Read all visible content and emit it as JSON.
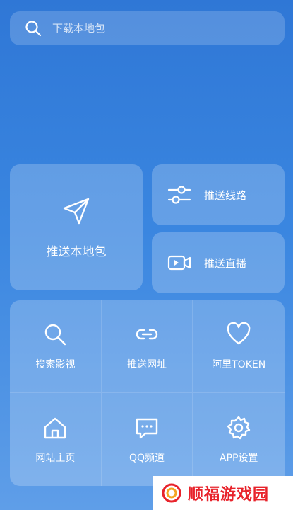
{
  "search": {
    "placeholder": "下载本地包"
  },
  "cards": {
    "push_package": {
      "label": "推送本地包",
      "icon": "send-icon"
    },
    "push_route": {
      "label": "推送线路",
      "icon": "sliders-icon"
    },
    "push_live": {
      "label": "推送直播",
      "icon": "video-icon"
    }
  },
  "grid": [
    {
      "label": "搜索影视",
      "icon": "search-icon"
    },
    {
      "label": "推送网址",
      "icon": "link-icon"
    },
    {
      "label": "阿里TOKEN",
      "icon": "heart-icon"
    },
    {
      "label": "网站主页",
      "icon": "home-icon"
    },
    {
      "label": "QQ频道",
      "icon": "chat-icon"
    },
    {
      "label": "APP设置",
      "icon": "gear-icon"
    }
  ],
  "watermark": {
    "text": "顺福游戏园"
  },
  "colors": {
    "accent": "#3a86e0",
    "watermark_red": "#e8232b"
  }
}
